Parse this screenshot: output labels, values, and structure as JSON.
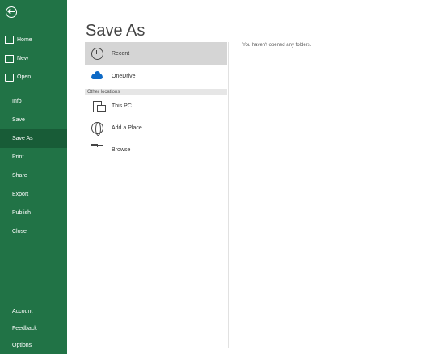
{
  "page": {
    "title": "Save As"
  },
  "sidebar": {
    "top": [
      {
        "label": "Home",
        "icon": "home-icon"
      },
      {
        "label": "New",
        "icon": "new-document-icon"
      },
      {
        "label": "Open",
        "icon": "open-folder-icon"
      }
    ],
    "main": [
      {
        "label": "Info"
      },
      {
        "label": "Save"
      },
      {
        "label": "Save As",
        "active": true
      },
      {
        "label": "Print"
      },
      {
        "label": "Share"
      },
      {
        "label": "Export"
      },
      {
        "label": "Publish"
      },
      {
        "label": "Close"
      }
    ],
    "bottom": [
      {
        "label": "Account"
      },
      {
        "label": "Feedback"
      },
      {
        "label": "Options"
      }
    ]
  },
  "locations": {
    "recent": "Recent",
    "onedrive": "OneDrive",
    "section_label": "Other locations",
    "this_pc": "This PC",
    "add_place": "Add a Place",
    "browse": "Browse"
  },
  "recent_empty_text": "You haven't opened any folders.",
  "colors": {
    "sidebar": "#217346",
    "sidebar_active": "#185c37",
    "selected": "#d5d5d5"
  }
}
